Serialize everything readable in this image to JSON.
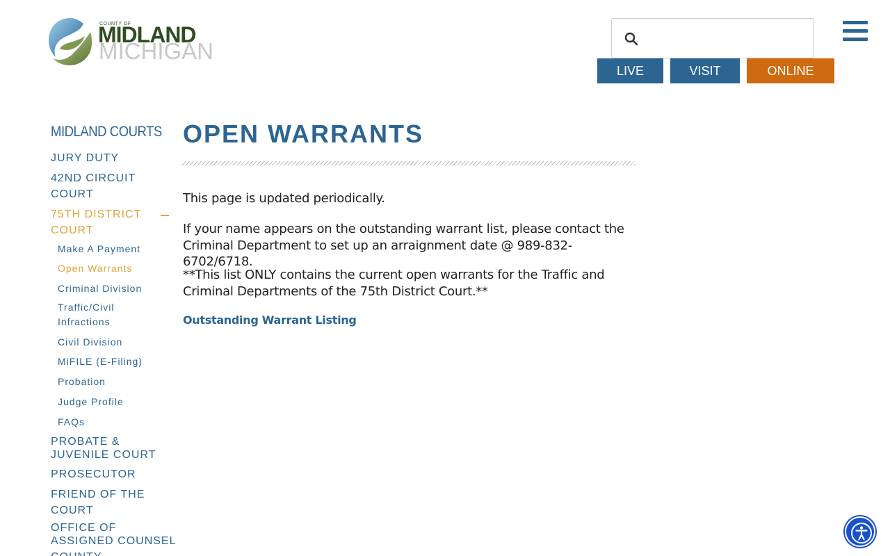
{
  "header": {
    "logo": {
      "small": "COUNTY OF",
      "main": "MIDLAND",
      "sub": "MICHIGAN"
    },
    "search": {
      "placeholder": "",
      "value": ""
    },
    "buttons": {
      "live": "LIVE",
      "visit": "VISIT",
      "online": "ONLINE"
    },
    "colors": {
      "primary": "#2c6592",
      "accent": "#d06a10",
      "active": "#e0a33a"
    }
  },
  "sidebar": {
    "heading": "MIDLAND COURTS",
    "items": [
      {
        "label": "JURY DUTY"
      },
      {
        "label_line1": "42ND CIRCUIT",
        "label_line2": "COURT"
      },
      {
        "label_line1": "75TH DISTRICT",
        "label_line2": "COURT",
        "active": true
      },
      {
        "label_line1": "PROBATE &",
        "label_line2": "JUVENILE COURT"
      },
      {
        "label": "PROSECUTOR"
      },
      {
        "label_line1": "FRIEND OF THE",
        "label_line2": "COURT"
      },
      {
        "label_line1": "OFFICE OF",
        "label_line2": "ASSIGNED COUNSEL"
      },
      {
        "label": "COUNTY"
      }
    ],
    "subitems": [
      {
        "label": "Make A Payment"
      },
      {
        "label": "Open Warrants",
        "active": true
      },
      {
        "label": "Criminal Division"
      },
      {
        "label_line1": "Traffic/Civil",
        "label_line2": "Infractions"
      },
      {
        "label": "Civil Division"
      },
      {
        "label": "MiFILE (E-Filing)"
      },
      {
        "label": "Probation"
      },
      {
        "label": "Judge Profile"
      },
      {
        "label": "FAQs"
      }
    ]
  },
  "main": {
    "title": "OPEN WARRANTS",
    "p1": "This page is updated periodically.",
    "p2": "If your name appears on the outstanding warrant list, please contact the Criminal Department to set up an arraignment date @ 989-832-6702/6718.",
    "p3": "**This list ONLY contains the current open warrants for the Traffic and Criminal Departments of the 75th District Court.**",
    "link": "Outstanding Warrant Listing"
  }
}
